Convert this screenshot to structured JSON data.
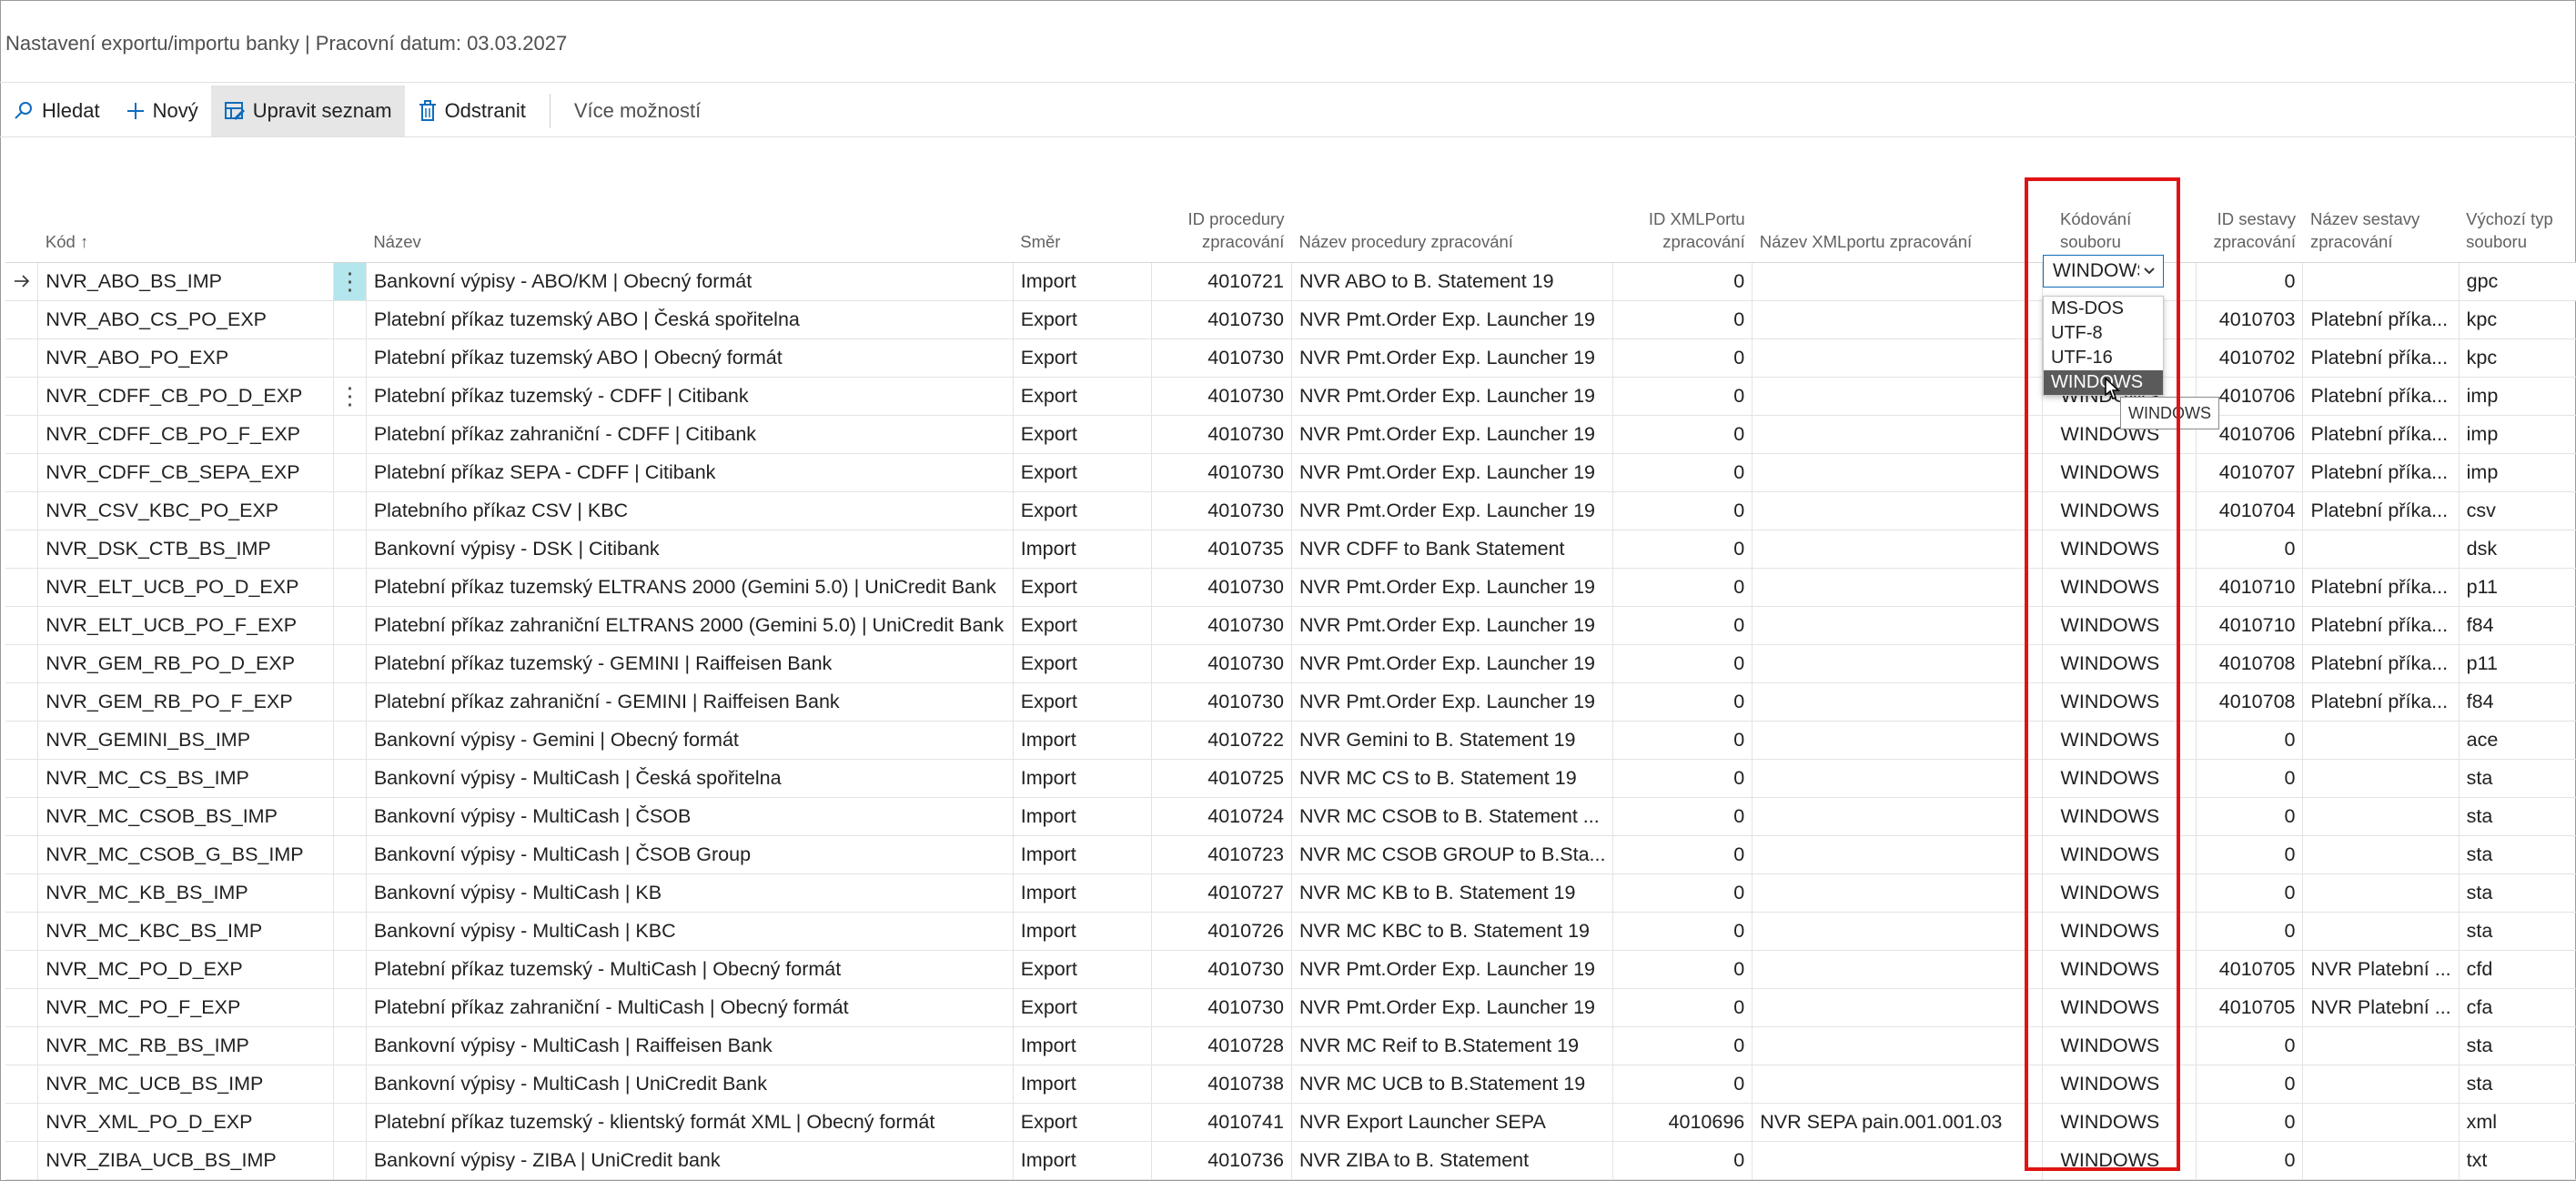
{
  "page": {
    "title": "Nastavení exportu/importu banky | Pracovní datum: 03.03.2027"
  },
  "toolbar": {
    "search": "Hledat",
    "new": "Nový",
    "edit_list": "Upravit seznam",
    "delete": "Odstranit",
    "more": "Více možností"
  },
  "columns": {
    "code": "Kód ↑",
    "name": "Název",
    "direction": "Směr",
    "proc_id": "ID procedury zpracování",
    "proc_name": "Název procedury zpracování",
    "xmlport_id": "ID XMLPortu zpracování",
    "xmlport_name": "Název XMLportu zpracování",
    "encoding": "Kódování souboru",
    "report_id": "ID sestavy zpracování",
    "report_name": "Název sestavy zpracování",
    "file_type": "Výchozí typ souboru"
  },
  "rows": [
    {
      "code": "NVR_ABO_BS_IMP",
      "name": "Bankovní výpisy - ABO/KM | Obecný formát",
      "direction": "Import",
      "proc_id": "4010721",
      "proc_name": "NVR ABO to B. Statement 19",
      "xmlport_id": "0",
      "xmlport_name": "",
      "encoding": "WINDOWS",
      "report_id": "0",
      "report_name": "",
      "file_type": "gpc"
    },
    {
      "code": "NVR_ABO_CS_PO_EXP",
      "name": "Platební příkaz tuzemský ABO | Česká spořitelna",
      "direction": "Export",
      "proc_id": "4010730",
      "proc_name": "NVR Pmt.Order Exp. Launcher 19",
      "xmlport_id": "0",
      "xmlport_name": "",
      "encoding": "WINDOWS",
      "report_id": "4010703",
      "report_name": "Platební příka...",
      "file_type": "kpc"
    },
    {
      "code": "NVR_ABO_PO_EXP",
      "name": "Platební příkaz tuzemský ABO | Obecný formát",
      "direction": "Export",
      "proc_id": "4010730",
      "proc_name": "NVR Pmt.Order Exp. Launcher 19",
      "xmlport_id": "0",
      "xmlport_name": "",
      "encoding": "WINDOWS",
      "report_id": "4010702",
      "report_name": "Platební příka...",
      "file_type": "kpc"
    },
    {
      "code": "NVR_CDFF_CB_PO_D_EXP",
      "name": "Platební příkaz tuzemský - CDFF | Citibank",
      "direction": "Export",
      "proc_id": "4010730",
      "proc_name": "NVR Pmt.Order Exp. Launcher 19",
      "xmlport_id": "0",
      "xmlport_name": "",
      "encoding": "WINDOWS",
      "report_id": "4010706",
      "report_name": "Platební příka...",
      "file_type": "imp"
    },
    {
      "code": "NVR_CDFF_CB_PO_F_EXP",
      "name": "Platební příkaz zahraniční - CDFF | Citibank",
      "direction": "Export",
      "proc_id": "4010730",
      "proc_name": "NVR Pmt.Order Exp. Launcher 19",
      "xmlport_id": "0",
      "xmlport_name": "",
      "encoding": "WINDOWS",
      "report_id": "4010706",
      "report_name": "Platební příka...",
      "file_type": "imp"
    },
    {
      "code": "NVR_CDFF_CB_SEPA_EXP",
      "name": "Platební příkaz SEPA - CDFF | Citibank",
      "direction": "Export",
      "proc_id": "4010730",
      "proc_name": "NVR Pmt.Order Exp. Launcher 19",
      "xmlport_id": "0",
      "xmlport_name": "",
      "encoding": "WINDOWS",
      "report_id": "4010707",
      "report_name": "Platební příka...",
      "file_type": "imp"
    },
    {
      "code": "NVR_CSV_KBC_PO_EXP",
      "name": "Platebního příkaz CSV | KBC",
      "direction": "Export",
      "proc_id": "4010730",
      "proc_name": "NVR Pmt.Order Exp. Launcher 19",
      "xmlport_id": "0",
      "xmlport_name": "",
      "encoding": "WINDOWS",
      "report_id": "4010704",
      "report_name": "Platební příka...",
      "file_type": "csv"
    },
    {
      "code": "NVR_DSK_CTB_BS_IMP",
      "name": "Bankovní výpisy - DSK | Citibank",
      "direction": "Import",
      "proc_id": "4010735",
      "proc_name": "NVR CDFF to Bank Statement",
      "xmlport_id": "0",
      "xmlport_name": "",
      "encoding": "WINDOWS",
      "report_id": "0",
      "report_name": "",
      "file_type": "dsk"
    },
    {
      "code": "NVR_ELT_UCB_PO_D_EXP",
      "name": "Platební příkaz tuzemský ELTRANS 2000 (Gemini 5.0) | UniCredit Bank",
      "direction": "Export",
      "proc_id": "4010730",
      "proc_name": "NVR Pmt.Order Exp. Launcher 19",
      "xmlport_id": "0",
      "xmlport_name": "",
      "encoding": "WINDOWS",
      "report_id": "4010710",
      "report_name": "Platební příka...",
      "file_type": "p11"
    },
    {
      "code": "NVR_ELT_UCB_PO_F_EXP",
      "name": "Platební příkaz zahraniční ELTRANS 2000 (Gemini 5.0) | UniCredit Bank",
      "direction": "Export",
      "proc_id": "4010730",
      "proc_name": "NVR Pmt.Order Exp. Launcher 19",
      "xmlport_id": "0",
      "xmlport_name": "",
      "encoding": "WINDOWS",
      "report_id": "4010710",
      "report_name": "Platební příka...",
      "file_type": "f84"
    },
    {
      "code": "NVR_GEM_RB_PO_D_EXP",
      "name": "Platební příkaz tuzemský - GEMINI | Raiffeisen Bank",
      "direction": "Export",
      "proc_id": "4010730",
      "proc_name": "NVR Pmt.Order Exp. Launcher 19",
      "xmlport_id": "0",
      "xmlport_name": "",
      "encoding": "WINDOWS",
      "report_id": "4010708",
      "report_name": "Platební příka...",
      "file_type": "p11"
    },
    {
      "code": "NVR_GEM_RB_PO_F_EXP",
      "name": "Platební příkaz zahraniční - GEMINI | Raiffeisen Bank",
      "direction": "Export",
      "proc_id": "4010730",
      "proc_name": "NVR Pmt.Order Exp. Launcher 19",
      "xmlport_id": "0",
      "xmlport_name": "",
      "encoding": "WINDOWS",
      "report_id": "4010708",
      "report_name": "Platební příka...",
      "file_type": "f84"
    },
    {
      "code": "NVR_GEMINI_BS_IMP",
      "name": "Bankovní výpisy - Gemini | Obecný formát",
      "direction": "Import",
      "proc_id": "4010722",
      "proc_name": "NVR Gemini to B. Statement 19",
      "xmlport_id": "0",
      "xmlport_name": "",
      "encoding": "WINDOWS",
      "report_id": "0",
      "report_name": "",
      "file_type": "ace"
    },
    {
      "code": "NVR_MC_CS_BS_IMP",
      "name": "Bankovní výpisy - MultiCash | Česká spořitelna",
      "direction": "Import",
      "proc_id": "4010725",
      "proc_name": "NVR MC CS to B. Statement 19",
      "xmlport_id": "0",
      "xmlport_name": "",
      "encoding": "WINDOWS",
      "report_id": "0",
      "report_name": "",
      "file_type": "sta"
    },
    {
      "code": "NVR_MC_CSOB_BS_IMP",
      "name": "Bankovní výpisy - MultiCash | ČSOB",
      "direction": "Import",
      "proc_id": "4010724",
      "proc_name": "NVR MC CSOB to B. Statement ...",
      "xmlport_id": "0",
      "xmlport_name": "",
      "encoding": "WINDOWS",
      "report_id": "0",
      "report_name": "",
      "file_type": "sta"
    },
    {
      "code": "NVR_MC_CSOB_G_BS_IMP",
      "name": "Bankovní výpisy - MultiCash | ČSOB Group",
      "direction": "Import",
      "proc_id": "4010723",
      "proc_name": "NVR MC CSOB GROUP to B.Sta...",
      "xmlport_id": "0",
      "xmlport_name": "",
      "encoding": "WINDOWS",
      "report_id": "0",
      "report_name": "",
      "file_type": "sta"
    },
    {
      "code": "NVR_MC_KB_BS_IMP",
      "name": "Bankovní výpisy - MultiCash | KB",
      "direction": "Import",
      "proc_id": "4010727",
      "proc_name": "NVR MC KB to B. Statement 19",
      "xmlport_id": "0",
      "xmlport_name": "",
      "encoding": "WINDOWS",
      "report_id": "0",
      "report_name": "",
      "file_type": "sta"
    },
    {
      "code": "NVR_MC_KBC_BS_IMP",
      "name": "Bankovní výpisy - MultiCash | KBC",
      "direction": "Import",
      "proc_id": "4010726",
      "proc_name": "NVR MC KBC to B. Statement 19",
      "xmlport_id": "0",
      "xmlport_name": "",
      "encoding": "WINDOWS",
      "report_id": "0",
      "report_name": "",
      "file_type": "sta"
    },
    {
      "code": "NVR_MC_PO_D_EXP",
      "name": "Platební příkaz tuzemský - MultiCash | Obecný formát",
      "direction": "Export",
      "proc_id": "4010730",
      "proc_name": "NVR Pmt.Order Exp. Launcher 19",
      "xmlport_id": "0",
      "xmlport_name": "",
      "encoding": "WINDOWS",
      "report_id": "4010705",
      "report_name": "NVR Platební ...",
      "file_type": "cfd"
    },
    {
      "code": "NVR_MC_PO_F_EXP",
      "name": "Platební příkaz zahraniční - MultiCash | Obecný formát",
      "direction": "Export",
      "proc_id": "4010730",
      "proc_name": "NVR Pmt.Order Exp. Launcher 19",
      "xmlport_id": "0",
      "xmlport_name": "",
      "encoding": "WINDOWS",
      "report_id": "4010705",
      "report_name": "NVR Platební ...",
      "file_type": "cfa"
    },
    {
      "code": "NVR_MC_RB_BS_IMP",
      "name": "Bankovní výpisy - MultiCash | Raiffeisen Bank",
      "direction": "Import",
      "proc_id": "4010728",
      "proc_name": "NVR MC Reif to B.Statement 19",
      "xmlport_id": "0",
      "xmlport_name": "",
      "encoding": "WINDOWS",
      "report_id": "0",
      "report_name": "",
      "file_type": "sta"
    },
    {
      "code": "NVR_MC_UCB_BS_IMP",
      "name": "Bankovní výpisy - MultiCash | UniCredit Bank",
      "direction": "Import",
      "proc_id": "4010738",
      "proc_name": "NVR MC UCB to B.Statement 19",
      "xmlport_id": "0",
      "xmlport_name": "",
      "encoding": "WINDOWS",
      "report_id": "0",
      "report_name": "",
      "file_type": "sta"
    },
    {
      "code": "NVR_XML_PO_D_EXP",
      "name": "Platební příkaz tuzemský - klientský formát XML | Obecný formát",
      "direction": "Export",
      "proc_id": "4010741",
      "proc_name": "NVR Export Launcher SEPA",
      "xmlport_id": "4010696",
      "xmlport_name": "NVR SEPA pain.001.001.03",
      "encoding": "WINDOWS",
      "report_id": "0",
      "report_name": "",
      "file_type": "xml"
    },
    {
      "code": "NVR_ZIBA_UCB_BS_IMP",
      "name": "Bankovní výpisy - ZIBA | UniCredit bank",
      "direction": "Import",
      "proc_id": "4010736",
      "proc_name": "NVR ZIBA to B. Statement",
      "xmlport_id": "0",
      "xmlport_name": "",
      "encoding": "WINDOWS",
      "report_id": "0",
      "report_name": "",
      "file_type": "txt"
    }
  ],
  "encoding_dropdown": {
    "current": "WINDOWS",
    "options": [
      "MS-DOS",
      "UTF-8",
      "UTF-16",
      "WINDOWS"
    ],
    "highlighted": "WINDOWS",
    "tooltip": "WINDOWS"
  },
  "icons": {
    "search": "search-icon",
    "new": "plus-icon",
    "edit_list": "edit-list-icon",
    "delete": "trash-icon",
    "row_marker": "arrow-right-icon",
    "row_actions": "more-vertical-icon"
  },
  "colors": {
    "highlight_border": "#e01414",
    "selected_cell": "#b4e6ee",
    "focus_border": "#0f6cbd",
    "accent_icon": "#0f6cbd"
  }
}
